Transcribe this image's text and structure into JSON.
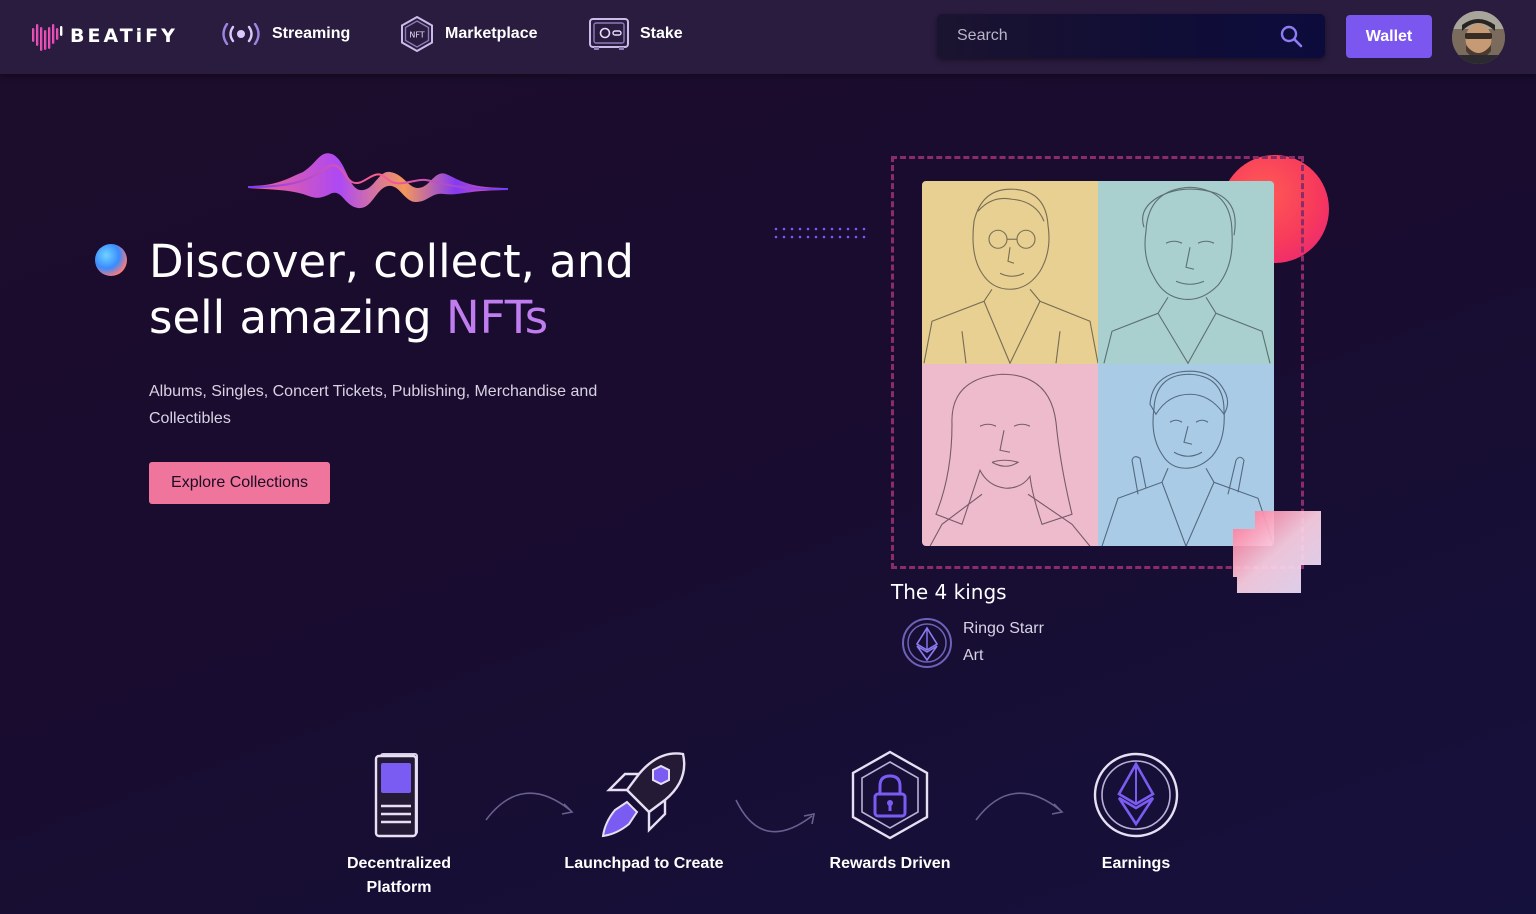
{
  "nav": {
    "brand": "BEATiFY",
    "items": [
      {
        "label": "Streaming",
        "icon": "broadcast-icon"
      },
      {
        "label": "Marketplace",
        "icon": "nft-hexagon-icon"
      },
      {
        "label": "Stake",
        "icon": "safe-icon"
      }
    ],
    "search_placeholder": "Search",
    "wallet_label": "Wallet"
  },
  "hero": {
    "title_plain": "Discover, collect, and sell amazing ",
    "title_accent": "NFTs",
    "subtitle": "Albums, Singles, Concert Tickets, Publishing, Merchandise and Collectibles",
    "cta_label": "Explore Collections"
  },
  "featured_nft": {
    "title": "The 4 kings",
    "creator": "Ringo Starr",
    "collection": "Art",
    "panel_colors": [
      "#e8cf92",
      "#a9cfcf",
      "#eebbcc",
      "#a9cbe6"
    ]
  },
  "features": [
    {
      "label": "Decentralized Platform",
      "icon": "document-icon"
    },
    {
      "label": "Launchpad to Create",
      "icon": "rocket-icon"
    },
    {
      "label": "Rewards Driven",
      "icon": "lock-hexagon-icon"
    },
    {
      "label": "Earnings",
      "icon": "ethereum-icon"
    }
  ],
  "colors": {
    "accent_purple": "#7b57f0",
    "accent_pink": "#f0759c",
    "title_accent": "#c07df0"
  }
}
